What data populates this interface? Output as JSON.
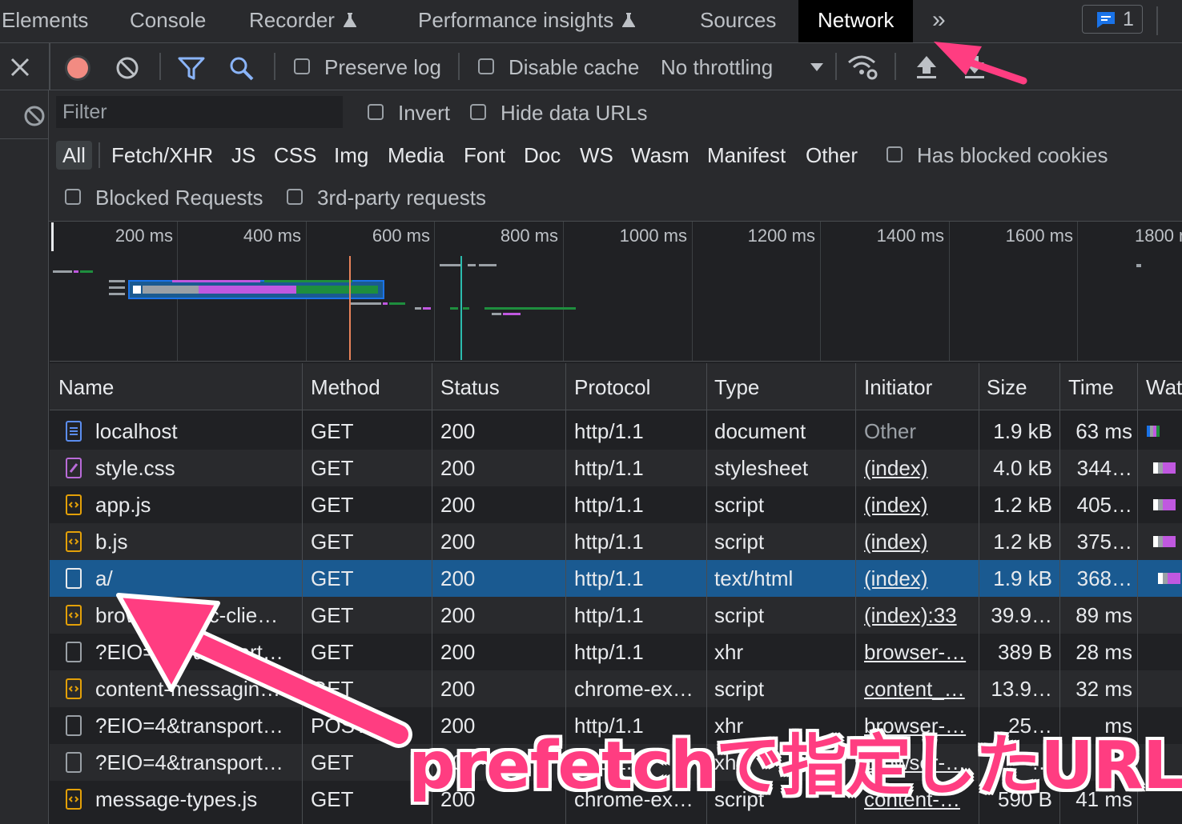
{
  "tabs": [
    {
      "label": "Elements",
      "experimental": false
    },
    {
      "label": "Console",
      "experimental": false
    },
    {
      "label": "Recorder",
      "experimental": true
    },
    {
      "label": "Performance insights",
      "experimental": true
    },
    {
      "label": "Sources",
      "experimental": false
    },
    {
      "label": "Network",
      "experimental": false,
      "active": true
    }
  ],
  "more_tabs_glyph": "»",
  "issues_count": "1",
  "toolbar": {
    "preserve_log": "Preserve log",
    "disable_cache": "Disable cache",
    "throttling": "No throttling"
  },
  "filter": {
    "placeholder": "Filter",
    "invert": "Invert",
    "hide_data_urls": "Hide data URLs",
    "types": [
      "All",
      "Fetch/XHR",
      "JS",
      "CSS",
      "Img",
      "Media",
      "Font",
      "Doc",
      "WS",
      "Wasm",
      "Manifest",
      "Other"
    ],
    "has_blocked_cookies": "Has blocked cookies",
    "blocked_requests": "Blocked Requests",
    "third_party": "3rd-party requests"
  },
  "overview": {
    "ticks": [
      "200 ms",
      "400 ms",
      "600 ms",
      "800 ms",
      "1000 ms",
      "1200 ms",
      "1400 ms",
      "1600 ms",
      "1800 ms"
    ]
  },
  "columns": [
    "Name",
    "Method",
    "Status",
    "Protocol",
    "Type",
    "Initiator",
    "Size",
    "Time",
    "Wat"
  ],
  "rows": [
    {
      "name": "localhost",
      "method": "GET",
      "status": "200",
      "protocol": "http/1.1",
      "type": "document",
      "initiator": "Other",
      "size": "1.9 kB",
      "time": "63 ms",
      "icon": "document-icon"
    },
    {
      "name": "style.css",
      "method": "GET",
      "status": "200",
      "protocol": "http/1.1",
      "type": "stylesheet",
      "initiator": "(index)",
      "size": "4.0 kB",
      "time": "344…",
      "icon": "stylesheet-icon"
    },
    {
      "name": "app.js",
      "method": "GET",
      "status": "200",
      "protocol": "http/1.1",
      "type": "script",
      "initiator": "(index)",
      "size": "1.2 kB",
      "time": "405…",
      "icon": "script-icon"
    },
    {
      "name": "b.js",
      "method": "GET",
      "status": "200",
      "protocol": "http/1.1",
      "type": "script",
      "initiator": "(index)",
      "size": "1.2 kB",
      "time": "375…",
      "icon": "script-icon"
    },
    {
      "name": "a/",
      "method": "GET",
      "status": "200",
      "protocol": "http/1.1",
      "type": "text/html",
      "initiator": "(index)",
      "size": "1.9 kB",
      "time": "368…",
      "icon": "html-file-icon",
      "selected": true
    },
    {
      "name": "browser-sync-clie…",
      "method": "GET",
      "status": "200",
      "protocol": "http/1.1",
      "type": "script",
      "initiator": "(index):33",
      "size": "39.9…",
      "time": "89 ms",
      "icon": "script-icon"
    },
    {
      "name": "?EIO=4&transport…",
      "method": "GET",
      "status": "200",
      "protocol": "http/1.1",
      "type": "xhr",
      "initiator": "browser-…",
      "size": "389 B",
      "time": "28 ms",
      "icon": "xhr-icon"
    },
    {
      "name": "content-messagin…",
      "method": "GET",
      "status": "200",
      "protocol": "chrome-ex…",
      "type": "script",
      "initiator": "content_…",
      "size": "13.9…",
      "time": "32 ms",
      "icon": "script-icon"
    },
    {
      "name": "?EIO=4&transport…",
      "method": "POST",
      "status": "200",
      "protocol": "http/1.1",
      "type": "xhr",
      "initiator": "browser-…",
      "size": "25…",
      "time": "ms",
      "icon": "xhr-icon"
    },
    {
      "name": "?EIO=4&transport…",
      "method": "GET",
      "status": "200",
      "protocol": "http/1.1",
      "type": "xhr",
      "initiator": "browser-…",
      "size": "…",
      "time": "s",
      "icon": "xhr-icon"
    },
    {
      "name": "message-types.js",
      "method": "GET",
      "status": "200",
      "protocol": "chrome-ex…",
      "type": "script",
      "initiator": "content-…",
      "size": "590 B",
      "time": "41 ms",
      "icon": "script-icon"
    }
  ],
  "annotation": "prefetchで指定したURL",
  "colors": {
    "accent_pink": "#ff3d81",
    "selected_row": "#1a5a91",
    "record_red": "#f28b82",
    "filter_blue": "#8ab4f8"
  }
}
